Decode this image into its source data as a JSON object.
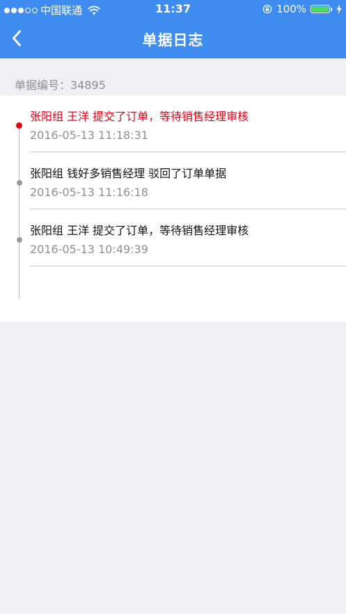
{
  "status_bar": {
    "carrier": "中国联通",
    "time": "11:37",
    "battery": "100%",
    "signal_strength": 3,
    "signal_total": 5
  },
  "nav": {
    "title": "单据日志",
    "back_icon": "chevron-left-icon"
  },
  "document": {
    "number_label": "单据编号：",
    "number_value": "34895"
  },
  "log_entries": [
    {
      "text": "张阳组 王洋 提交了订单，等待销售经理审核",
      "time": "2016-05-13 11:18:31",
      "active": true
    },
    {
      "text": "张阳组 钱好多销售经理 驳回了订单单据",
      "time": "2016-05-13 11:16:18",
      "active": false
    },
    {
      "text": "张阳组 王洋 提交了订单，等待销售经理审核",
      "time": "2016-05-13 10:49:39",
      "active": false
    }
  ],
  "colors": {
    "header": "#3e8cf0",
    "active": "#e60012",
    "battery": "#4cd964"
  }
}
